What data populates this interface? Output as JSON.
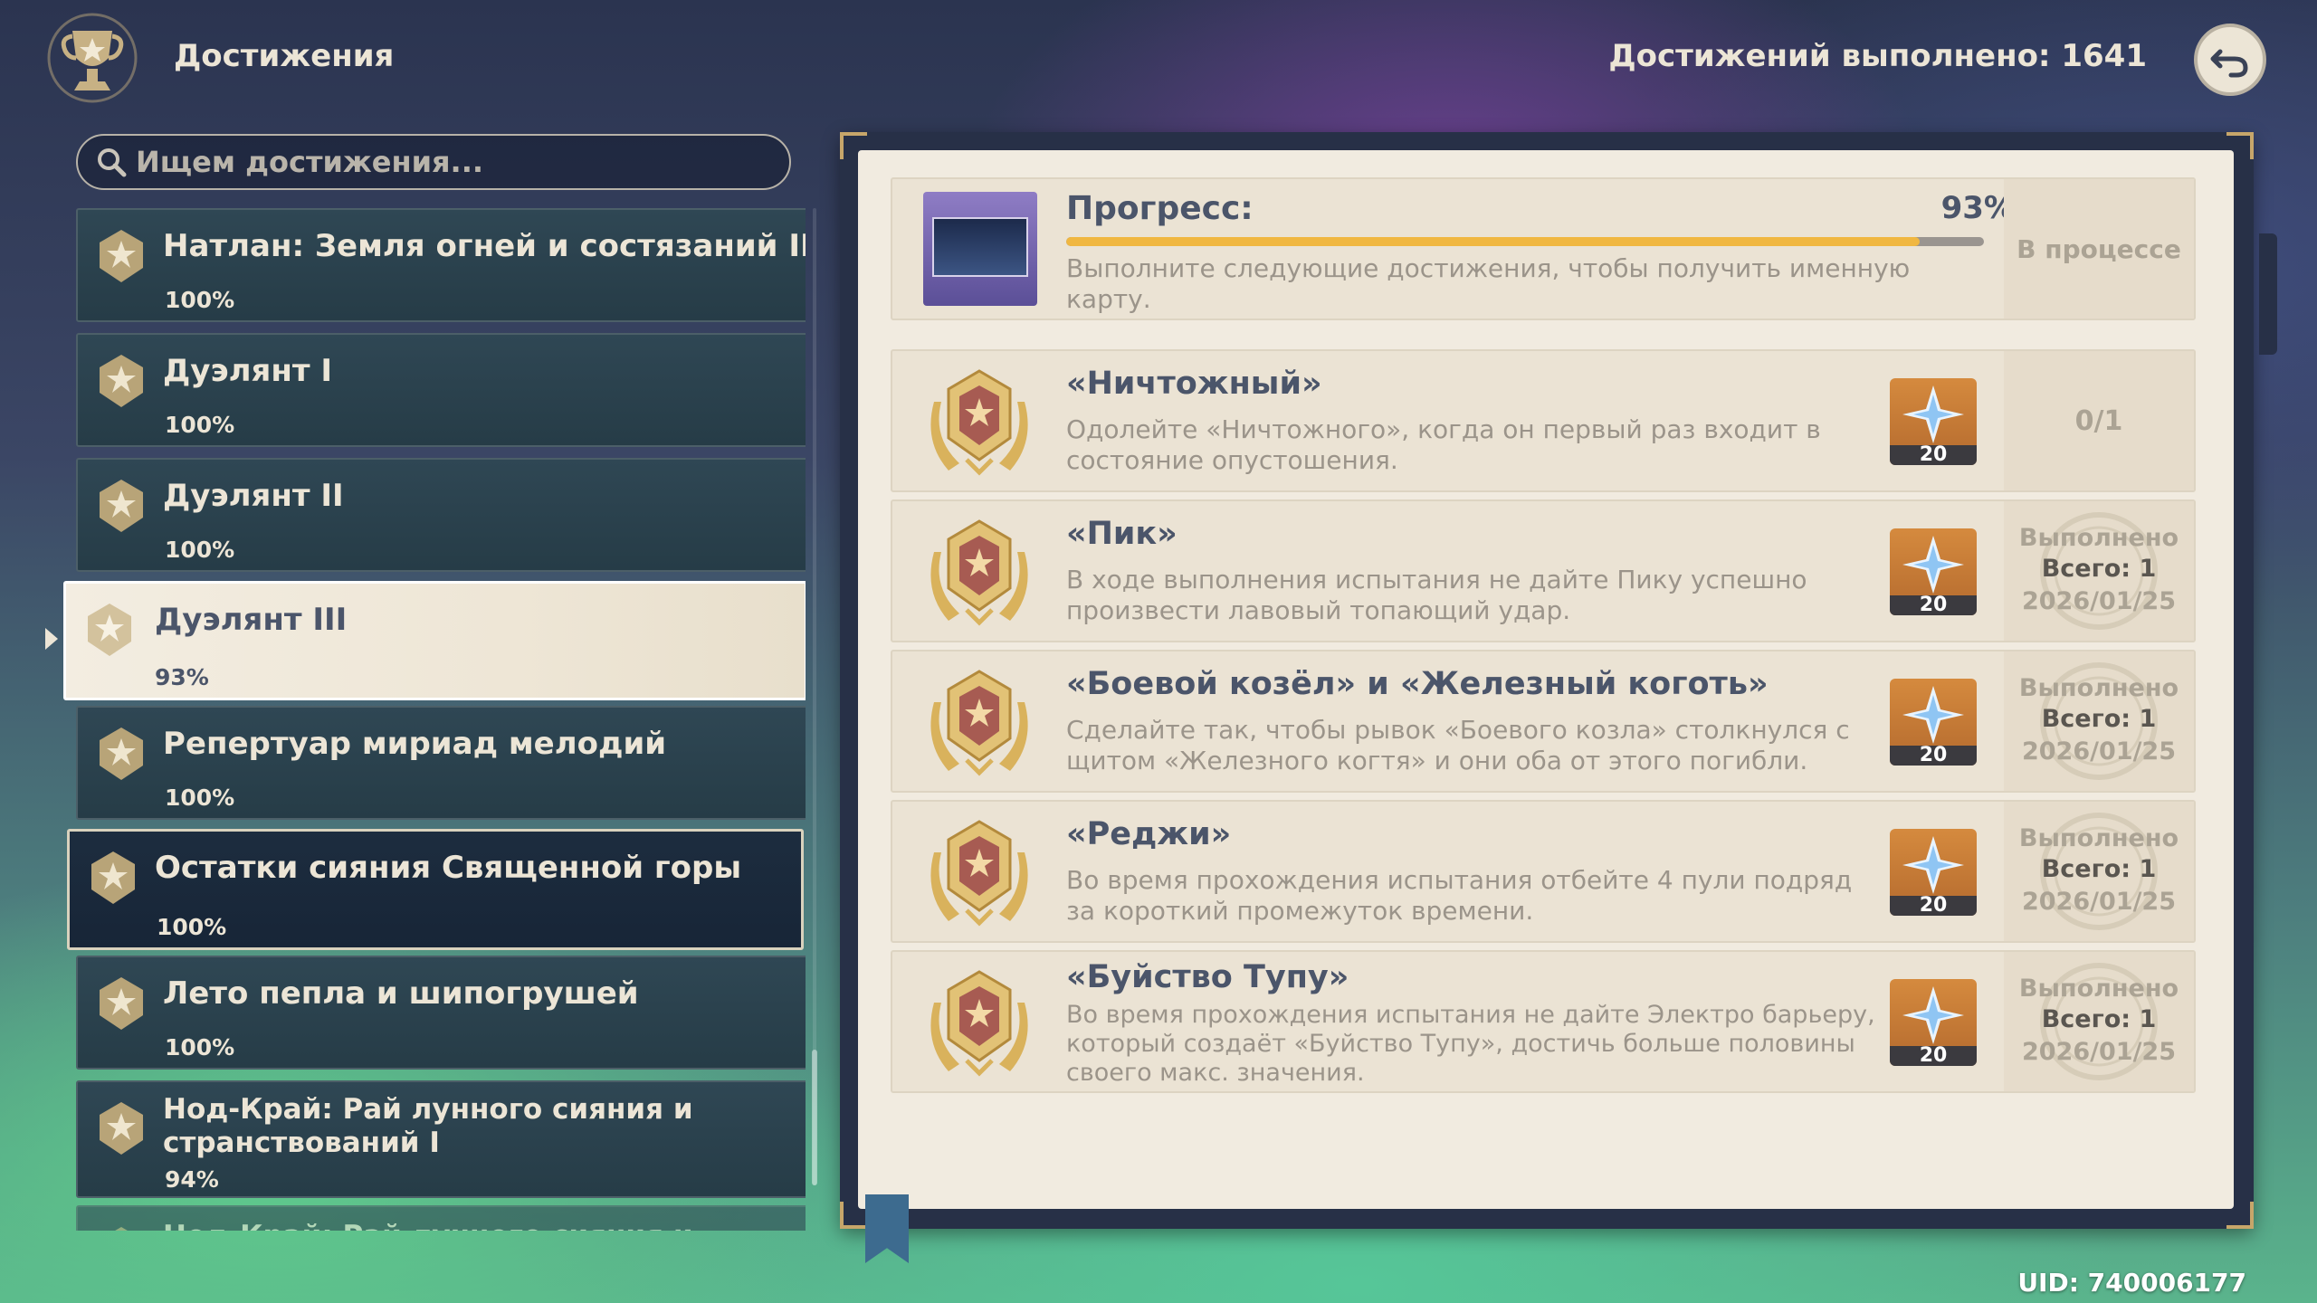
{
  "header": {
    "title": "Достижения",
    "completed_label": "Достижений выполнено: 1641"
  },
  "search": {
    "placeholder": "Ищем достижения..."
  },
  "categories": [
    {
      "name": "Натлан: Земля огней и состязаний II",
      "percent": "100%"
    },
    {
      "name": "Дуэлянт I",
      "percent": "100%"
    },
    {
      "name": "Дуэлянт II",
      "percent": "100%"
    },
    {
      "name": "Дуэлянт III",
      "percent": "93%"
    },
    {
      "name": "Репертуар мириад мелодий",
      "percent": "100%"
    },
    {
      "name": "Остатки сияния Священной горы",
      "percent": "100%"
    },
    {
      "name": "Лето пепла и шипогрушей",
      "percent": "100%"
    },
    {
      "name": "Нод-Край: Рай лунного сияния и странствований I",
      "percent": "94%"
    },
    {
      "name": "Нод-Край: Рай лунного сияния и",
      "percent": ""
    }
  ],
  "progress": {
    "title": "Прогресс:",
    "percent_label": "93%",
    "fraction": 0.93,
    "description": "Выполните следующие достижения, чтобы получить именную карту.",
    "status": "В процессе"
  },
  "achievements": [
    {
      "title": "«Ничтожный»",
      "description": "Одолейте «Ничтожного», когда он первый раз входит в состояние опустошения.",
      "reward": "20",
      "count": "0/1"
    },
    {
      "title": "«Пик»",
      "description": "В ходе выполнения испытания не дайте Пику успешно произвести лавовый топающий удар.",
      "reward": "20",
      "done_label": "Выполнено",
      "total_label": "Всего: 1",
      "date": "2026/01/25"
    },
    {
      "title": "«Боевой козёл» и «Железный коготь»",
      "description": "Сделайте так, чтобы рывок «Боевого козла» столкнулся с щитом «Железного когтя» и они оба от этого погибли.",
      "reward": "20",
      "done_label": "Выполнено",
      "total_label": "Всего: 1",
      "date": "2026/01/25"
    },
    {
      "title": "«Реджи»",
      "description": "Во время прохождения испытания отбейте 4 пули подряд за короткий промежуток времени.",
      "reward": "20",
      "done_label": "Выполнено",
      "total_label": "Всего: 1",
      "date": "2026/01/25"
    },
    {
      "title": "«Буйство Тупу»",
      "description": "Во время прохождения испытания не дайте Электро барьеру, который создаёт «Буйство Тупу», достичь больше половины своего макс. значения.",
      "reward": "20",
      "done_label": "Выполнено",
      "total_label": "Всего: 1",
      "date": "2026/01/25"
    }
  ],
  "footer": {
    "uid": "UID: 740006177"
  },
  "icons": {
    "trophy": "trophy-icon",
    "back": "back-arrow-icon",
    "search": "search-icon",
    "category": "achievement-badge-icon",
    "medal": "gold-medal-icon",
    "primogem": "primogem-icon"
  },
  "colors": {
    "accent_progress": "#f0b741",
    "panel_text": "#4b556a",
    "reward_bg": "#c77a35"
  }
}
